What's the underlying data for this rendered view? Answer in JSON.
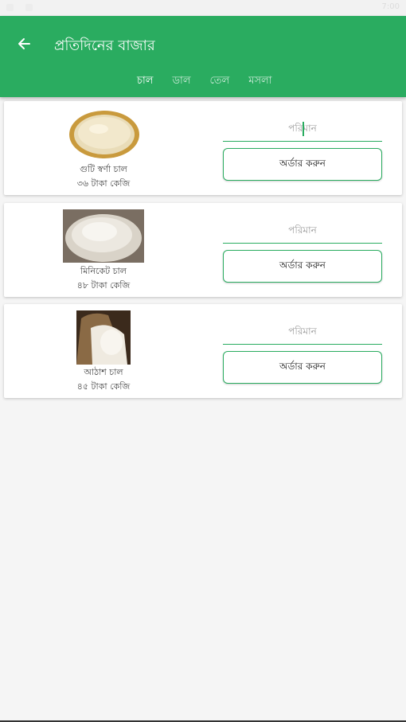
{
  "status_bar": {
    "time": "7:00"
  },
  "app_bar": {
    "back_icon": "arrow-left-icon",
    "title": "প্রতিদিনের বাজার"
  },
  "tabs": [
    {
      "label": "চাল",
      "active": true
    },
    {
      "label": "ডাল",
      "active": false
    },
    {
      "label": "তেল",
      "active": false
    },
    {
      "label": "মসলা",
      "active": false
    }
  ],
  "products": [
    {
      "name": "গুটি স্বর্ণা চাল",
      "price": "৩৬ টাকা কেজি",
      "quantity_placeholder": "পরিমান",
      "order_label": "অর্ডার করুন",
      "image": "rice-bowl-image"
    },
    {
      "name": "মিনিকেট চাল",
      "price": "৪৮ টাকা কেজি",
      "quantity_placeholder": "পরিমান",
      "order_label": "অর্ডার করুন",
      "image": "rice-heap-image"
    },
    {
      "name": "আঠাশ চাল",
      "price": "৪৫ টাকা কেজি",
      "quantity_placeholder": "পরিমান",
      "order_label": "অর্ডার করুন",
      "image": "rice-sack-image"
    }
  ],
  "colors": {
    "primary": "#2aac60",
    "background": "#f5f5f5",
    "card": "#ffffff"
  }
}
